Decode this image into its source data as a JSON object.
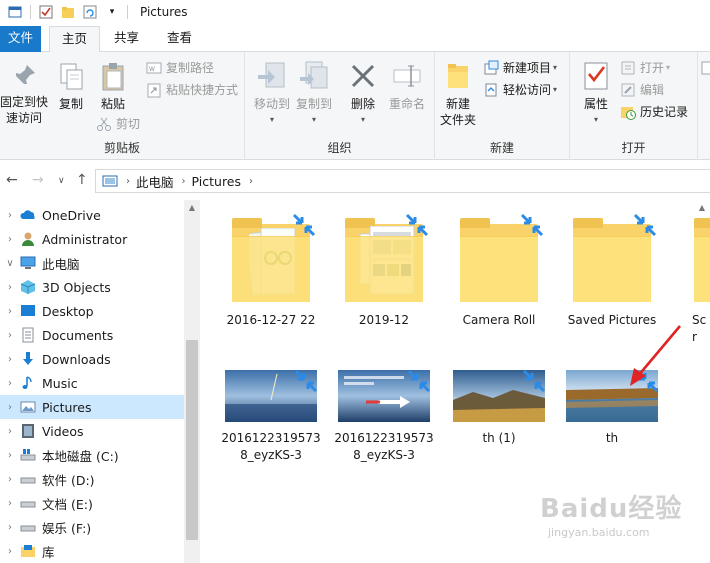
{
  "window": {
    "title": "Pictures"
  },
  "ribbon_tabs": {
    "file": "文件",
    "home": "主页",
    "share": "共享",
    "view": "查看"
  },
  "ribbon": {
    "clipboard": {
      "group_label": "剪贴板",
      "pin_line1": "固定到快",
      "pin_line2": "速访问",
      "copy": "复制",
      "paste": "粘贴",
      "copy_path": "复制路径",
      "paste_shortcut": "粘贴快捷方式",
      "cut": "剪切"
    },
    "organize": {
      "group_label": "组织",
      "move_to": "移动到",
      "copy_to": "复制到",
      "delete": "删除",
      "rename": "重命名"
    },
    "new": {
      "group_label": "新建",
      "new_folder_line1": "新建",
      "new_folder_line2": "文件夹",
      "new_item": "新建项目",
      "easy_access": "轻松访问"
    },
    "open": {
      "group_label": "打开",
      "properties": "属性",
      "open": "打开",
      "edit": "编辑",
      "history": "历史记录"
    }
  },
  "address_bar": {
    "crumbs": [
      "此电脑",
      "Pictures"
    ]
  },
  "nav_pane": {
    "items": [
      {
        "label": "OneDrive",
        "icon": "cloud-icon",
        "selected": false,
        "expanded": false
      },
      {
        "label": "Administrator",
        "icon": "user-icon",
        "selected": false,
        "expanded": false
      },
      {
        "label": "此电脑",
        "icon": "computer-icon",
        "selected": false,
        "expanded": true
      },
      {
        "label": "3D Objects",
        "icon": "cube-icon",
        "selected": false,
        "expanded": false
      },
      {
        "label": "Desktop",
        "icon": "desktop-icon",
        "selected": false,
        "expanded": false
      },
      {
        "label": "Documents",
        "icon": "documents-icon",
        "selected": false,
        "expanded": false
      },
      {
        "label": "Downloads",
        "icon": "download-icon",
        "selected": false,
        "expanded": false
      },
      {
        "label": "Music",
        "icon": "music-icon",
        "selected": false,
        "expanded": false
      },
      {
        "label": "Pictures",
        "icon": "pictures-icon",
        "selected": true,
        "expanded": false
      },
      {
        "label": "Videos",
        "icon": "videos-icon",
        "selected": false,
        "expanded": false
      },
      {
        "label": "本地磁盘 (C:)",
        "icon": "drive-icon",
        "selected": false,
        "expanded": false
      },
      {
        "label": "软件 (D:)",
        "icon": "drive-icon",
        "selected": false,
        "expanded": false
      },
      {
        "label": "文档 (E:)",
        "icon": "drive-icon",
        "selected": false,
        "expanded": false
      },
      {
        "label": "娱乐 (F:)",
        "icon": "drive-icon",
        "selected": false,
        "expanded": false
      },
      {
        "label": "库",
        "icon": "library-icon",
        "selected": false,
        "expanded": false
      }
    ]
  },
  "content": {
    "folders": [
      {
        "name": "2016-12-27 22"
      },
      {
        "name": "2019-12"
      },
      {
        "name": "Camera Roll"
      },
      {
        "name": "Saved Pictures"
      },
      {
        "name": "Scr"
      }
    ],
    "files": [
      {
        "name": "2016122319573 8_eyzKS-3"
      },
      {
        "name": "2016122319573 8_eyzKS-3"
      },
      {
        "name": "th (1)"
      },
      {
        "name": "th"
      }
    ]
  },
  "watermark": {
    "brand": "Baidu经验",
    "url": "jingyan.baidu.com"
  },
  "colors": {
    "accent": "#1979ca",
    "selection": "#cce8ff",
    "folder": "#fde27c",
    "sync_arrow": "#2b8be6",
    "annotation_arrow": "#e02424"
  }
}
